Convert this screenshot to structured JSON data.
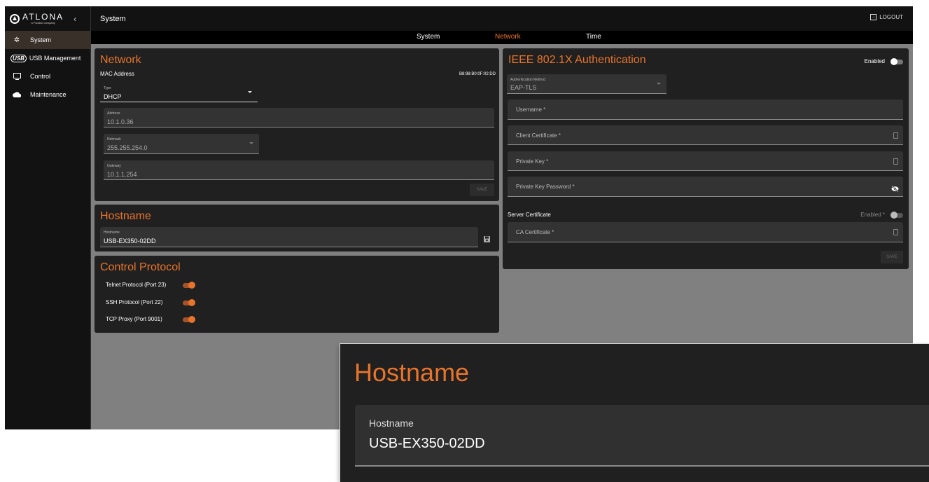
{
  "brand": {
    "logo_text": "ATLONA",
    "logo_sub": "a Panduit company",
    "collapse_icon": "chevron-left-icon"
  },
  "sidebar": {
    "items": [
      {
        "label": "System",
        "icon": "gear-icon",
        "active": true
      },
      {
        "label": "USB Management",
        "icon": "usb-icon",
        "badge": "USB",
        "active": false
      },
      {
        "label": "Control",
        "icon": "monitor-icon",
        "active": false
      },
      {
        "label": "Maintenance",
        "icon": "cloud-icon",
        "active": false
      }
    ]
  },
  "header": {
    "title": "System",
    "logout_label": "LOGOUT"
  },
  "tabs": [
    {
      "label": "System",
      "active": false
    },
    {
      "label": "Network",
      "active": true
    },
    {
      "label": "Time",
      "active": false
    }
  ],
  "network": {
    "title": "Network",
    "mac_label": "MAC Address",
    "mac_value": "B8:98:B0:0F:02:DD",
    "type": {
      "label": "Type",
      "value": "DHCP"
    },
    "address": {
      "label": "Address",
      "value": "10.1.0.36"
    },
    "netmask": {
      "label": "Netmask",
      "value": "255.255.254.0"
    },
    "gateway": {
      "label": "Gateway",
      "value": "10.1.1.254"
    },
    "save_label": "SAVE"
  },
  "hostname": {
    "title": "Hostname",
    "label": "Hostname",
    "value": "USB-EX350-02DD",
    "save_icon": "floppy-disk-icon"
  },
  "control_protocol": {
    "title": "Control Protocol",
    "items": [
      {
        "label": "Telnet Protocol (Port 23)",
        "enabled": true
      },
      {
        "label": "SSH Protocol (Port 22)",
        "enabled": true
      },
      {
        "label": "TCP Proxy (Port 9001)",
        "enabled": true
      }
    ]
  },
  "ieee": {
    "title": "IEEE 802.1X Authentication",
    "enabled_label": "Enabled",
    "enabled": false,
    "auth_method": {
      "label": "Authentication Method",
      "value": "EAP-TLS"
    },
    "username_placeholder": "Username *",
    "client_cert_placeholder": "Client Certificate *",
    "private_key_placeholder": "Private Key *",
    "private_key_password_placeholder": "Private Key Password *",
    "server_cert_label": "Server Certificate",
    "server_cert_enabled_label": "Enabled *",
    "server_cert_enabled": false,
    "ca_cert_placeholder": "CA Certificate *",
    "save_label": "SAVE"
  },
  "zoom": {
    "title": "Hostname",
    "label": "Hostname",
    "value": "USB-EX350-02DD"
  },
  "colors": {
    "accent": "#e8742c",
    "panel": "#202020",
    "background": "#808080",
    "sidebar": "#121212"
  }
}
